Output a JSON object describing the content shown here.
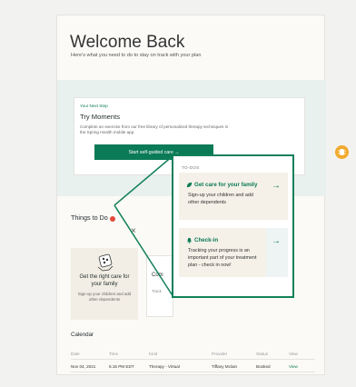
{
  "page": {
    "title": "Welcome Back",
    "subtitle": "Here's what you need to do to stay on track with your plan"
  },
  "next_step": {
    "label": "Your Next Step",
    "title": "Try Moments",
    "description": "Complete an exercise from our free library of personalized therapy techniques in the Spring Health mobile app.",
    "button": "Start self-guided care  →"
  },
  "things_to_do": {
    "heading": "Things to Do",
    "close": "×",
    "card1": {
      "title": "Get the right care for your family",
      "description": "Sign-up your children and add other dependents"
    },
    "card2": {
      "title": "Com",
      "description": "Track"
    }
  },
  "popup": {
    "label": "TO-DOS",
    "items": [
      {
        "title": "Get care for your family",
        "description": "Sign-up your children and add other dependents",
        "arrow": "→"
      },
      {
        "title": "Check-in",
        "description": "Tracking your progress is an important part of your treatment plan - check in now!",
        "arrow": "→"
      }
    ]
  },
  "calendar": {
    "heading": "Calendar",
    "columns": [
      "Date",
      "Time",
      "Kind",
      "Provider",
      "Status",
      "View"
    ],
    "rows": [
      {
        "date": "Nov 04, 2021",
        "time": "5:15 PM EDT",
        "kind": "Therapy - Virtual",
        "provider": "Tiffany Mclain",
        "status": "Booked",
        "view": "View"
      }
    ]
  },
  "colors": {
    "brand_green": "#0b7a56",
    "alert_red": "#e24a3a",
    "badge_orange": "#f2a92e"
  }
}
